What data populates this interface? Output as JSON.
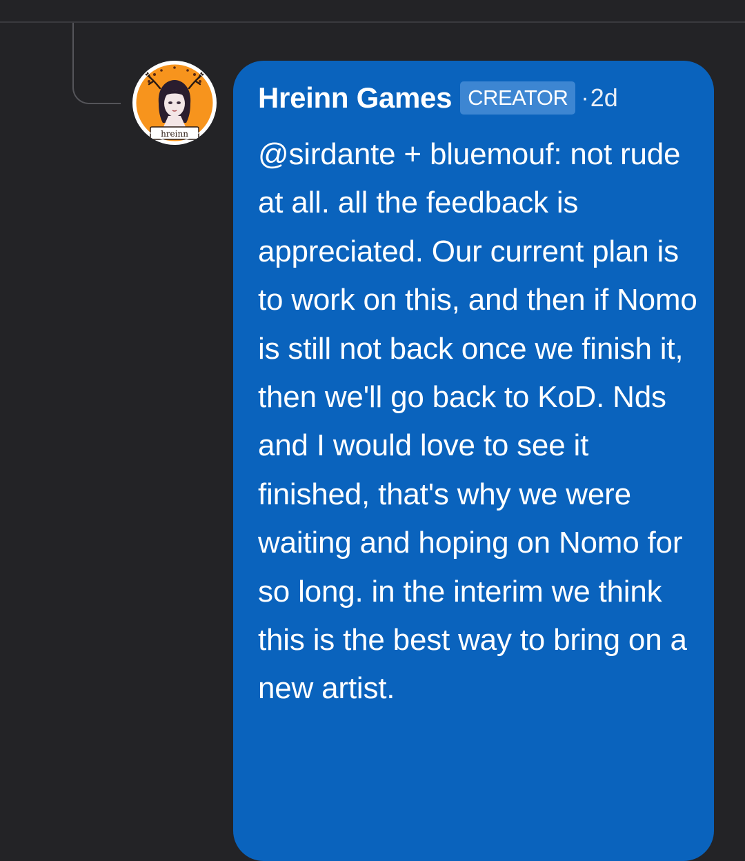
{
  "comment": {
    "author": "Hreinn Games",
    "role_badge": "CREATOR",
    "separator": "·",
    "timestamp": "2d",
    "body": "@sirdante + bluemouf: not rude at all. all the feedback is appreciated. Our current plan is to work on this, and then if Nomo is still not back once we finish it, then we'll go back to KoD. Nds and I would love to see it finished, that's why we were waiting and hoping on Nomo for so long. in the interim we think this is the best way to bring on a new artist.",
    "avatar": {
      "logo_text": "hreinn"
    }
  },
  "colors": {
    "background": "#232326",
    "bubble": "#0a63bd",
    "badge": "#3d86d2",
    "avatar_orange": "#f7941d"
  }
}
